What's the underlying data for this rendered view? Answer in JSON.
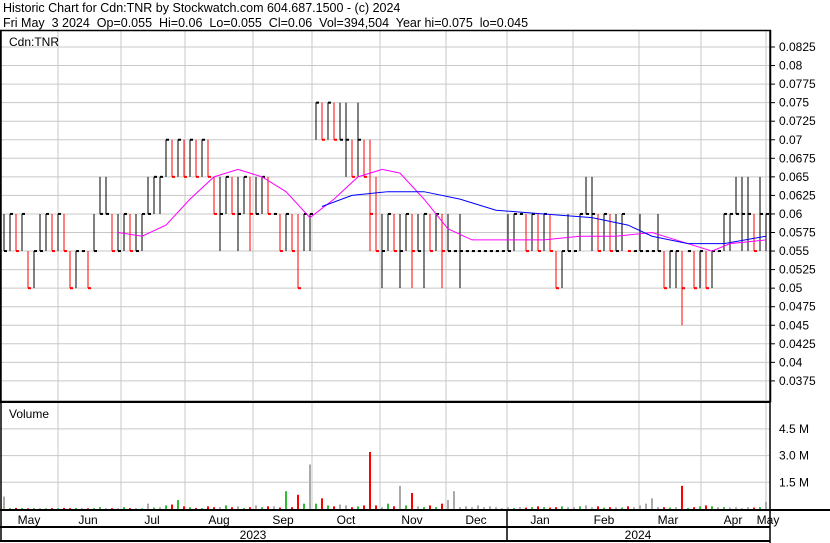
{
  "header": {
    "line1": "Historic Chart for Cdn:TNR by Stockwatch.com 604.687.1500 - (c) 2024",
    "line2": "Fri May  3 2024  Op=0.055  Hi=0.06  Lo=0.055  Cl=0.06  Vol=394,504  Year hi=0.075  lo=0.045"
  },
  "colors": {
    "up": "#000000",
    "down": "#ff0000",
    "ma_short": "#ff00ff",
    "ma_long": "#0000ff",
    "vol_up": "#33bb33",
    "vol_down": "#ff0000",
    "vol_flat": "#aaaaaa",
    "grid": "#c8c8c8"
  },
  "chart_data": [
    {
      "type": "ohlc",
      "title": "Cdn:TNR",
      "ylim": [
        0.035,
        0.085
      ],
      "yticks": [
        "0.0825",
        "0.08",
        "0.0775",
        "0.075",
        "0.0725",
        "0.07",
        "0.0675",
        "0.065",
        "0.0625",
        "0.06",
        "0.0575",
        "0.055",
        "0.0525",
        "0.05",
        "0.0475",
        "0.045",
        "0.0425",
        "0.04",
        "0.0375"
      ],
      "bars_hlc": [
        [
          0.06,
          0.055,
          0.055
        ],
        [
          0.06,
          0.055,
          0.06
        ],
        [
          0.06,
          0.055,
          0.055
        ],
        [
          0.06,
          0.055,
          0.06
        ],
        [
          0.055,
          0.05,
          0.05
        ],
        [
          0.055,
          0.05,
          0.055
        ],
        [
          0.06,
          0.055,
          0.055
        ],
        [
          0.06,
          0.055,
          0.06
        ],
        [
          0.06,
          0.055,
          0.055
        ],
        [
          0.06,
          0.055,
          0.06
        ],
        [
          0.06,
          0.055,
          0.055
        ],
        [
          0.055,
          0.05,
          0.05
        ],
        [
          0.055,
          0.05,
          0.055
        ],
        [
          0.055,
          0.055,
          0.055
        ],
        [
          0.055,
          0.05,
          0.05
        ],
        [
          0.06,
          0.055,
          0.055
        ],
        [
          0.065,
          0.06,
          0.06
        ],
        [
          0.065,
          0.06,
          0.06
        ],
        [
          0.06,
          0.055,
          0.055
        ],
        [
          0.06,
          0.055,
          0.055
        ],
        [
          0.06,
          0.055,
          0.06
        ],
        [
          0.06,
          0.055,
          0.055
        ],
        [
          0.06,
          0.055,
          0.055
        ],
        [
          0.06,
          0.055,
          0.06
        ],
        [
          0.065,
          0.06,
          0.06
        ],
        [
          0.065,
          0.06,
          0.065
        ],
        [
          0.065,
          0.06,
          0.065
        ],
        [
          0.07,
          0.065,
          0.07
        ],
        [
          0.07,
          0.065,
          0.065
        ],
        [
          0.07,
          0.065,
          0.07
        ],
        [
          0.07,
          0.065,
          0.065
        ],
        [
          0.07,
          0.065,
          0.07
        ],
        [
          0.07,
          0.065,
          0.065
        ],
        [
          0.07,
          0.065,
          0.07
        ],
        [
          0.07,
          0.065,
          0.065
        ],
        [
          0.065,
          0.06,
          0.06
        ],
        [
          0.065,
          0.055,
          0.06
        ],
        [
          0.065,
          0.06,
          0.065
        ],
        [
          0.065,
          0.06,
          0.06
        ],
        [
          0.065,
          0.055,
          0.06
        ],
        [
          0.065,
          0.06,
          0.065
        ],
        [
          0.065,
          0.055,
          0.06
        ],
        [
          0.065,
          0.06,
          0.06
        ],
        [
          0.065,
          0.06,
          0.065
        ],
        [
          0.065,
          0.06,
          0.06
        ],
        [
          0.06,
          0.06,
          0.06
        ],
        [
          0.06,
          0.055,
          0.055
        ],
        [
          0.06,
          0.055,
          0.06
        ],
        [
          0.06,
          0.055,
          0.055
        ],
        [
          0.06,
          0.05,
          0.05
        ],
        [
          0.06,
          0.055,
          0.06
        ],
        [
          0.06,
          0.055,
          0.06
        ],
        [
          0.075,
          0.07,
          0.075
        ],
        [
          0.075,
          0.07,
          0.07
        ],
        [
          0.075,
          0.07,
          0.075
        ],
        [
          0.075,
          0.07,
          0.07
        ],
        [
          0.075,
          0.07,
          0.07
        ],
        [
          0.075,
          0.065,
          0.07
        ],
        [
          0.07,
          0.065,
          0.065
        ],
        [
          0.075,
          0.065,
          0.07
        ],
        [
          0.07,
          0.065,
          0.065
        ],
        [
          0.07,
          0.055,
          0.06
        ],
        [
          0.065,
          0.055,
          0.055
        ],
        [
          0.06,
          0.05,
          0.055
        ],
        [
          0.06,
          0.055,
          0.06
        ],
        [
          0.06,
          0.055,
          0.055
        ],
        [
          0.06,
          0.05,
          0.055
        ],
        [
          0.06,
          0.055,
          0.06
        ],
        [
          0.06,
          0.05,
          0.055
        ],
        [
          0.06,
          0.055,
          0.055
        ],
        [
          0.06,
          0.05,
          0.06
        ],
        [
          0.06,
          0.055,
          0.055
        ],
        [
          0.06,
          0.055,
          0.06
        ],
        [
          0.06,
          0.05,
          0.055
        ],
        [
          0.06,
          0.055,
          0.055
        ],
        [
          0.055,
          0.055,
          0.055
        ],
        [
          0.06,
          0.05,
          0.055
        ],
        [
          0.055,
          0.055,
          0.055
        ],
        [
          0.055,
          0.055,
          0.055
        ],
        [
          0.055,
          0.055,
          0.055
        ],
        [
          0.055,
          0.055,
          0.055
        ],
        [
          0.055,
          0.055,
          0.055
        ],
        [
          0.055,
          0.055,
          0.055
        ],
        [
          0.055,
          0.055,
          0.055
        ],
        [
          0.06,
          0.055,
          0.055
        ],
        [
          0.06,
          0.055,
          0.06
        ],
        [
          0.06,
          0.06,
          0.06
        ],
        [
          0.06,
          0.055,
          0.055
        ],
        [
          0.06,
          0.055,
          0.06
        ],
        [
          0.06,
          0.055,
          0.055
        ],
        [
          0.06,
          0.055,
          0.06
        ],
        [
          0.06,
          0.055,
          0.055
        ],
        [
          0.055,
          0.05,
          0.05
        ],
        [
          0.055,
          0.05,
          0.055
        ],
        [
          0.06,
          0.055,
          0.055
        ],
        [
          0.055,
          0.055,
          0.055
        ],
        [
          0.06,
          0.055,
          0.06
        ],
        [
          0.065,
          0.06,
          0.06
        ],
        [
          0.065,
          0.055,
          0.06
        ],
        [
          0.06,
          0.055,
          0.055
        ],
        [
          0.06,
          0.055,
          0.06
        ],
        [
          0.06,
          0.055,
          0.055
        ],
        [
          0.06,
          0.055,
          0.055
        ],
        [
          0.06,
          0.055,
          0.06
        ],
        [
          0.055,
          0.055,
          0.055
        ],
        [
          0.055,
          0.055,
          0.055
        ],
        [
          0.06,
          0.055,
          0.055
        ],
        [
          0.055,
          0.055,
          0.055
        ],
        [
          0.055,
          0.055,
          0.055
        ],
        [
          0.06,
          0.055,
          0.055
        ],
        [
          0.055,
          0.05,
          0.05
        ],
        [
          0.055,
          0.05,
          0.055
        ],
        [
          0.055,
          0.05,
          0.055
        ],
        [
          0.055,
          0.045,
          0.05
        ],
        [
          0.055,
          0.055,
          0.055
        ],
        [
          0.055,
          0.05,
          0.05
        ],
        [
          0.055,
          0.05,
          0.055
        ],
        [
          0.055,
          0.05,
          0.05
        ],
        [
          0.055,
          0.05,
          0.055
        ],
        [
          0.055,
          0.055,
          0.055
        ],
        [
          0.06,
          0.055,
          0.06
        ],
        [
          0.06,
          0.055,
          0.06
        ],
        [
          0.065,
          0.06,
          0.06
        ],
        [
          0.065,
          0.055,
          0.06
        ],
        [
          0.065,
          0.055,
          0.06
        ],
        [
          0.06,
          0.055,
          0.055
        ],
        [
          0.065,
          0.055,
          0.06
        ],
        [
          0.06,
          0.055,
          0.06
        ]
      ],
      "ma_short": [
        [
          19,
          0.0575
        ],
        [
          23,
          0.057
        ],
        [
          27,
          0.0585
        ],
        [
          31,
          0.062
        ],
        [
          35,
          0.065
        ],
        [
          39,
          0.066
        ],
        [
          43,
          0.065
        ],
        [
          47,
          0.063
        ],
        [
          51,
          0.0595
        ],
        [
          55,
          0.062
        ],
        [
          59,
          0.065
        ],
        [
          63,
          0.066
        ],
        [
          66,
          0.0655
        ],
        [
          70,
          0.062
        ],
        [
          74,
          0.058
        ],
        [
          78,
          0.0565
        ],
        [
          84,
          0.0565
        ],
        [
          90,
          0.0565
        ],
        [
          96,
          0.057
        ],
        [
          102,
          0.057
        ],
        [
          108,
          0.0575
        ],
        [
          112,
          0.0565
        ],
        [
          118,
          0.055
        ],
        [
          121,
          0.056
        ],
        [
          127,
          0.0565
        ]
      ],
      "ma_long": [
        [
          53,
          0.061
        ],
        [
          58,
          0.0625
        ],
        [
          64,
          0.063
        ],
        [
          70,
          0.063
        ],
        [
          76,
          0.062
        ],
        [
          82,
          0.0605
        ],
        [
          90,
          0.06
        ],
        [
          98,
          0.0595
        ],
        [
          104,
          0.0585
        ],
        [
          108,
          0.057
        ],
        [
          114,
          0.056
        ],
        [
          120,
          0.056
        ],
        [
          127,
          0.057
        ]
      ]
    },
    {
      "type": "bar",
      "title": "Volume",
      "ylim": [
        0,
        6
      ],
      "yticks": [
        "4.5 M",
        "3.0 M",
        "1.5 M"
      ],
      "yticks_values": [
        4.5,
        3.0,
        1.5
      ],
      "values_millions": [
        0.7,
        0.05,
        0.06,
        0.05,
        0.04,
        0.05,
        0.05,
        0.04,
        0.05,
        0.04,
        0.06,
        0.05,
        0.06,
        0.05,
        0.04,
        0.05,
        0.1,
        0.05,
        0.05,
        0.04,
        0.1,
        0.05,
        0.05,
        0.04,
        0.3,
        0.08,
        0.1,
        0.2,
        0.25,
        0.5,
        0.15,
        0.1,
        0.06,
        0.05,
        0.15,
        0.1,
        0.1,
        0.2,
        0.1,
        0.15,
        0.05,
        0.1,
        0.2,
        0.1,
        0.15,
        0.15,
        0.08,
        1.0,
        0.1,
        0.8,
        0.3,
        2.5,
        0.3,
        0.6,
        0.2,
        0.15,
        0.25,
        0.2,
        0.1,
        0.15,
        0.2,
        3.2,
        0.2,
        0.1,
        0.3,
        0.15,
        1.3,
        0.2,
        0.9,
        0.15,
        0.1,
        0.2,
        0.1,
        0.3,
        0.5,
        1.0,
        0.1,
        0.15,
        0.1,
        0.2,
        0.1,
        0.15,
        0.1,
        0.05,
        0.1,
        0.05,
        0.1,
        0.08,
        0.1,
        0.15,
        0.1,
        0.08,
        0.1,
        0.15,
        0.1,
        0.1,
        0.15,
        0.2,
        0.1,
        0.15,
        0.08,
        0.1,
        0.1,
        0.08,
        0.15,
        0.1,
        0.2,
        0.3,
        0.6,
        0.1,
        0.1,
        0.08,
        0.1,
        1.3,
        0.05,
        0.1,
        0.15,
        0.2,
        0.15,
        0.1,
        0.1,
        0.08,
        0.1,
        0.05,
        0.1,
        0.08,
        0.1,
        0.4
      ]
    }
  ],
  "x_axis": {
    "months": [
      "May",
      "Jun",
      "Jul",
      "Aug",
      "Sep",
      "Oct",
      "Nov",
      "Dec",
      "Jan",
      "Feb",
      "Mar",
      "Apr",
      "May"
    ],
    "years": [
      "2023",
      "2024"
    ]
  }
}
